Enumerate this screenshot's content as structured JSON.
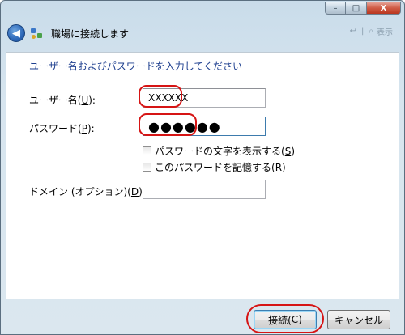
{
  "window": {
    "caption_buttons": {
      "minimize": "–",
      "maximize": "□",
      "close": "X"
    }
  },
  "nav": {
    "title": "職場に接続します",
    "right_hint": "表示"
  },
  "form": {
    "instruction": "ユーザー名およびパスワードを入力してください",
    "username": {
      "label_prefix": "ユーザー名(",
      "label_key": "U",
      "label_suffix": "):",
      "value": "XXXXXX"
    },
    "password": {
      "label_prefix": "パスワード(",
      "label_key": "P",
      "label_suffix": "):",
      "value_masked": "●●●●●●"
    },
    "show_chars": {
      "label_prefix": "パスワードの文字を表示する(",
      "label_key": "S",
      "label_suffix": ")",
      "checked": false
    },
    "remember": {
      "label_prefix": "このパスワードを記憶する(",
      "label_key": "R",
      "label_suffix": ")",
      "checked": false
    },
    "domain": {
      "label_prefix": "ドメイン (オプション)(",
      "label_key": "D",
      "label_suffix": "):",
      "value": ""
    }
  },
  "buttons": {
    "connect": {
      "prefix": "接続(",
      "key": "C",
      "suffix": ")"
    },
    "cancel": "キャンセル"
  },
  "colors": {
    "instruction": "#1e3f8f",
    "highlight": "#d61414",
    "window_frame": "#d7e5ef"
  }
}
